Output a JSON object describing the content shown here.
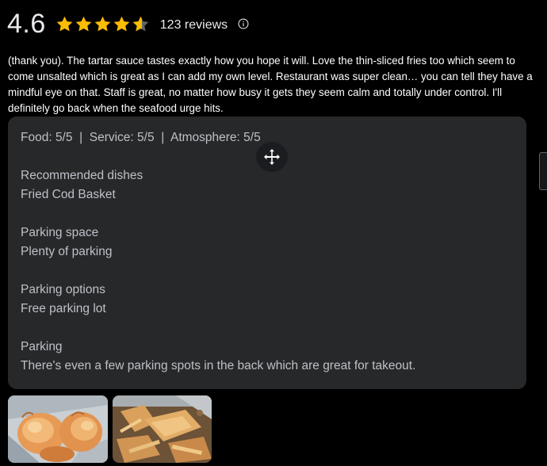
{
  "rating": {
    "score": "4.6",
    "stars_value": 4.6,
    "stars_max": 5,
    "review_count_label": "123 reviews",
    "star_color": "#fbbc04",
    "empty_star_color": "#5f6368"
  },
  "review": {
    "text": "(thank you). The tartar sauce tastes exactly how you hope it will. Love the thin-sliced fries too which seem to come unsalted which is great as I can add my own level. Restaurant was super clean… you can tell they have a mindful eye on that. Staff is great, no matter how busy it gets they seem calm and totally under control. I'll definitely go back when the seafood urge hits."
  },
  "details": {
    "ratings_line": "Food: 5/5  |  Service: 5/5  |  Atmosphere: 5/5",
    "sections": [
      {
        "heading": "Recommended dishes",
        "value": "Fried Cod Basket"
      },
      {
        "heading": "Parking space",
        "value": "Plenty of parking"
      },
      {
        "heading": "Parking options",
        "value": "Free parking lot"
      },
      {
        "heading": "Parking",
        "value": "There's even a few parking spots in the back which are great for takeout."
      }
    ]
  },
  "icons": {
    "info": "info-icon",
    "move": "move-icon"
  },
  "photos": [
    {
      "subject": "fried-shrimp-photo"
    },
    {
      "subject": "fried-fish-and-fries-photo"
    }
  ]
}
